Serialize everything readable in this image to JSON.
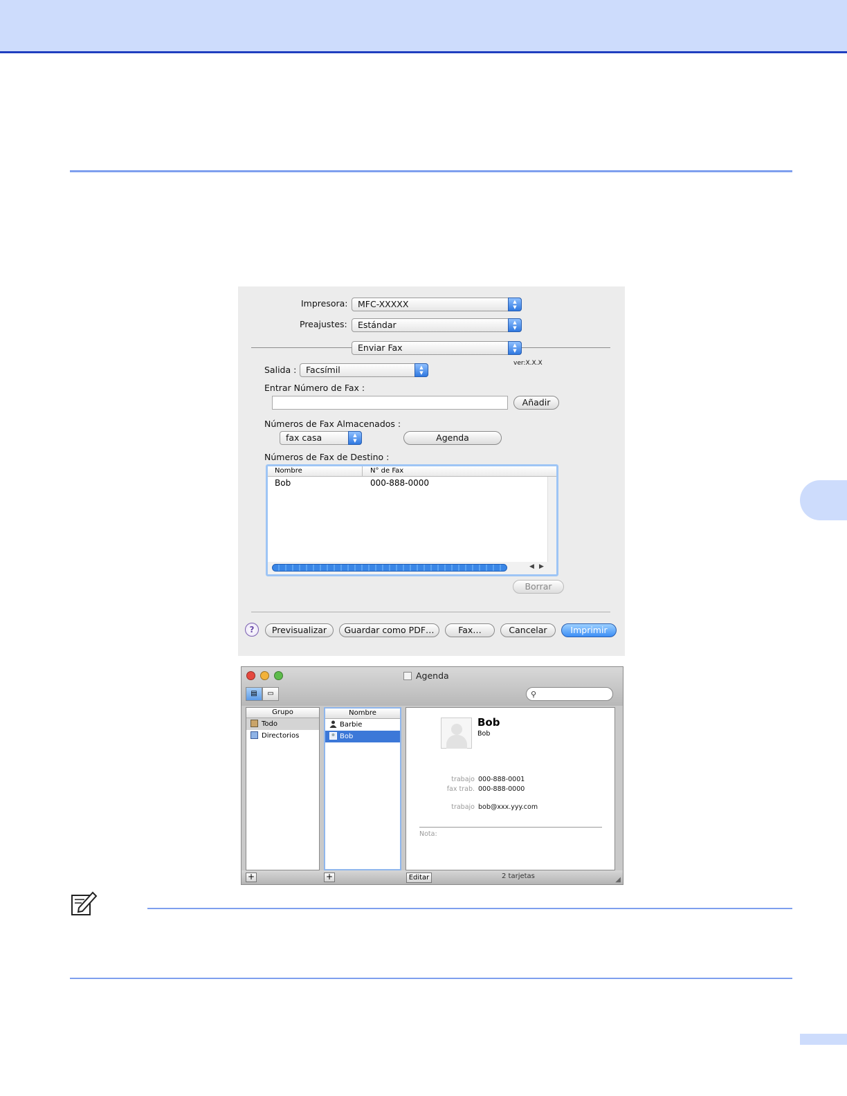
{
  "print_dialog": {
    "printer_label": "Impresora:",
    "printer_value": "MFC-XXXXX",
    "presets_label": "Preajustes:",
    "presets_value": "Estándar",
    "panel_value": "Enviar Fax",
    "version": "ver:X.X.X",
    "output_label": "Salida :",
    "output_value": "Facsímil",
    "enter_fax_label": "Entrar Número de Fax :",
    "add_button": "Añadir",
    "stored_label": "Números de Fax Almacenados :",
    "stored_value": "fax casa",
    "agenda_button": "Agenda",
    "dest_label": "Números de Fax de Destino :",
    "table": {
      "col_name": "Nombre",
      "col_fax": "N° de Fax",
      "rows": [
        {
          "name": "Bob",
          "fax": "000-888-0000"
        }
      ]
    },
    "delete_button": "Borrar",
    "help_icon": "question-icon",
    "help_glyph": "?",
    "buttons": {
      "preview": "Previsualizar",
      "save_pdf": "Guardar como PDF…",
      "fax": "Fax…",
      "cancel": "Cancelar",
      "print": "Imprimir"
    },
    "accent_color": "#3d8ef5"
  },
  "address_book": {
    "title": "Agenda",
    "group_header": "Grupo",
    "groups": [
      "Todo",
      "Directorios"
    ],
    "name_header": "Nombre",
    "names": [
      "Barbie",
      "Bob"
    ],
    "card": {
      "name": "Bob",
      "subname": "Bob",
      "fields": [
        {
          "label": "trabajo",
          "value": "000-888-0001"
        },
        {
          "label": "fax trab.",
          "value": "000-888-0000"
        },
        {
          "label": "trabajo",
          "value": "bob@xxx.yyy.com"
        }
      ],
      "note_label": "Nota:"
    },
    "edit_button": "Editar",
    "count": "2 tarjetas",
    "add_glyph": "+"
  }
}
